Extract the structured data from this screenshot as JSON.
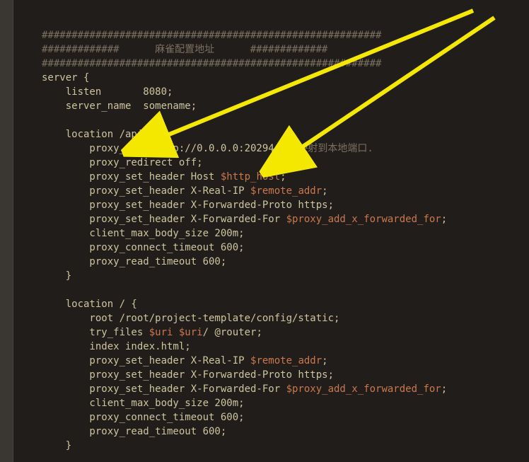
{
  "code": {
    "divider1": "#########################################################",
    "divider2a": "#############",
    "divider2_text": "麻雀配置地址",
    "divider2b": "#############",
    "divider3": "#########################################################",
    "server_open": "server {",
    "listen": "    listen       8080;",
    "server_name": "    server_name  somename;",
    "blank1": "",
    "loc_api": "    location /api/ {",
    "proxy_pass_label": "        proxy_pass http://0.0.0.0:20294/;",
    "proxy_pass_comment": " #映射到本地端口.",
    "proxy_redirect": "        proxy_redirect off;",
    "psh_host_a": "        proxy_set_header Host ",
    "psh_host_var": "$http_host",
    "psh_realip_a": "        proxy_set_header X-Real-IP ",
    "psh_realip_var": "$remote_addr",
    "psh_proto": "        proxy_set_header X-Forwarded-Proto https;",
    "psh_ffor_a": "        proxy_set_header X-Forwarded-For ",
    "psh_ffor_var": "$proxy_add_x_forwarded_for",
    "client_max": "        client_max_body_size 200m;",
    "proxy_conn": "        proxy_connect_timeout 600;",
    "proxy_read": "        proxy_read_timeout 600;",
    "close1": "    }",
    "blank2": "",
    "loc_root": "    location / {",
    "root": "        root /root/project-template/config/static;",
    "tryfiles_a": "        try_files ",
    "tryfiles_v1": "$uri",
    "tryfiles_b": " ",
    "tryfiles_v2": "$uri",
    "tryfiles_c": "/ @router;",
    "index": "        index index.html;",
    "psh2_realip_a": "        proxy_set_header X-Real-IP ",
    "psh2_realip_var": "$remote_addr",
    "psh2_proto": "        proxy_set_header X-Forwarded-Proto https;",
    "psh2_ffor_a": "        proxy_set_header X-Forwarded-For ",
    "psh2_ffor_var": "$proxy_add_x_forwarded_for",
    "client_max2": "        client_max_body_size 200m;",
    "proxy_conn2": "        proxy_connect_timeout 600;",
    "proxy_read2": "        proxy_read_timeout 600;",
    "close2": "    }"
  }
}
